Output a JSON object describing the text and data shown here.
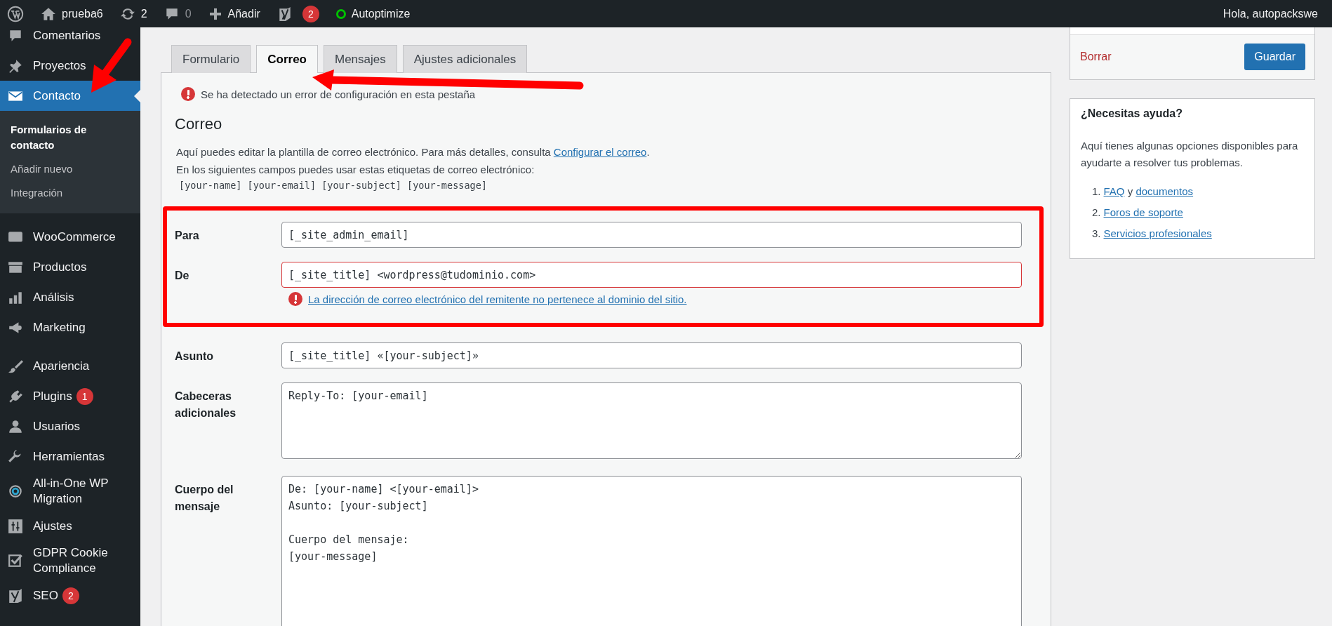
{
  "admin_bar": {
    "site": "prueba6",
    "updates": "2",
    "comments": "0",
    "new": "Añadir",
    "seo_badge": "2",
    "plugin": "Autoptimize",
    "greeting": "Hola, autopackswe"
  },
  "sidebar": {
    "groups": [
      [
        {
          "label": "Comentarios",
          "selected": false
        },
        {
          "label": "Proyectos",
          "selected": false
        },
        {
          "label": "Contacto",
          "selected": true,
          "submenu": [
            {
              "label": "Formularios de contacto",
              "selected": true
            },
            {
              "label": "Añadir nuevo",
              "selected": false
            },
            {
              "label": "Integración",
              "selected": false
            }
          ]
        }
      ],
      [
        {
          "label": "WooCommerce",
          "selected": false
        },
        {
          "label": "Productos",
          "selected": false
        },
        {
          "label": "Análisis",
          "selected": false
        },
        {
          "label": "Marketing",
          "selected": false
        }
      ],
      [
        {
          "label": "Apariencia",
          "selected": false
        },
        {
          "label": "Plugins",
          "selected": false,
          "badge": "1"
        },
        {
          "label": "Usuarios",
          "selected": false
        },
        {
          "label": "Herramientas",
          "selected": false
        },
        {
          "label": "All-in-One WP Migration",
          "selected": false
        },
        {
          "label": "Ajustes",
          "selected": false
        },
        {
          "label": "GDPR Cookie Compliance",
          "selected": false
        },
        {
          "label": "SEO",
          "selected": false,
          "badge": "2"
        }
      ]
    ]
  },
  "tabs": [
    {
      "label": "Formulario",
      "selected": false
    },
    {
      "label": "Correo",
      "selected": true
    },
    {
      "label": "Mensajes",
      "selected": false
    },
    {
      "label": "Ajustes adicionales",
      "selected": false
    }
  ],
  "panel": {
    "notice": "Se ha detectado un error de configuración en esta pestaña",
    "title": "Correo",
    "intro": "Aquí puedes editar la plantilla de correo electrónico. Para más detalles, consulta ",
    "intro_link": "Configurar el correo",
    "intro_end": ".",
    "tags_intro": "En los siguientes campos puedes usar estas etiquetas de correo electrónico:",
    "tags": "[your-name] [your-email] [your-subject] [your-message]",
    "fields": [
      {
        "label": "Para",
        "kind": "input",
        "value": "[_site_admin_email]",
        "invalid": false,
        "highlighted": true
      },
      {
        "label": "De",
        "kind": "input",
        "value": "[_site_title] <wordpress@tudominio.com>",
        "invalid": true,
        "error": "La dirección de correo electrónico del remitente no pertenece al dominio del sitio.",
        "highlighted": true
      },
      {
        "label": "Asunto",
        "kind": "input",
        "value": "[_site_title] «[your-subject]»",
        "invalid": false,
        "highlighted": false
      },
      {
        "label": "Cabeceras adicionales",
        "kind": "textarea",
        "value": "Reply-To: [your-email]",
        "invalid": false,
        "highlighted": false
      },
      {
        "label": "Cuerpo del mensaje",
        "kind": "textarea-tall",
        "value": "De: [your-name] <[your-email]>\nAsunto: [your-subject]\n\nCuerpo del mensaje:\n[your-message]",
        "invalid": false,
        "highlighted": false
      }
    ]
  },
  "actions": {
    "delete": "Borrar",
    "save": "Guardar"
  },
  "help": {
    "title": "¿Necesitas ayuda?",
    "text": "Aquí tienes algunas opciones disponibles para ayudarte a resolver tus problemas.",
    "items": [
      {
        "number": "1.",
        "parts": [
          {
            "text": "FAQ",
            "link": true
          },
          {
            "text": " y ",
            "link": false
          },
          {
            "text": "documentos",
            "link": true
          }
        ]
      },
      {
        "number": "2.",
        "parts": [
          {
            "text": "Foros de soporte",
            "link": true
          }
        ]
      },
      {
        "number": "3.",
        "parts": [
          {
            "text": "Servicios profesionales",
            "link": true
          }
        ]
      }
    ]
  }
}
